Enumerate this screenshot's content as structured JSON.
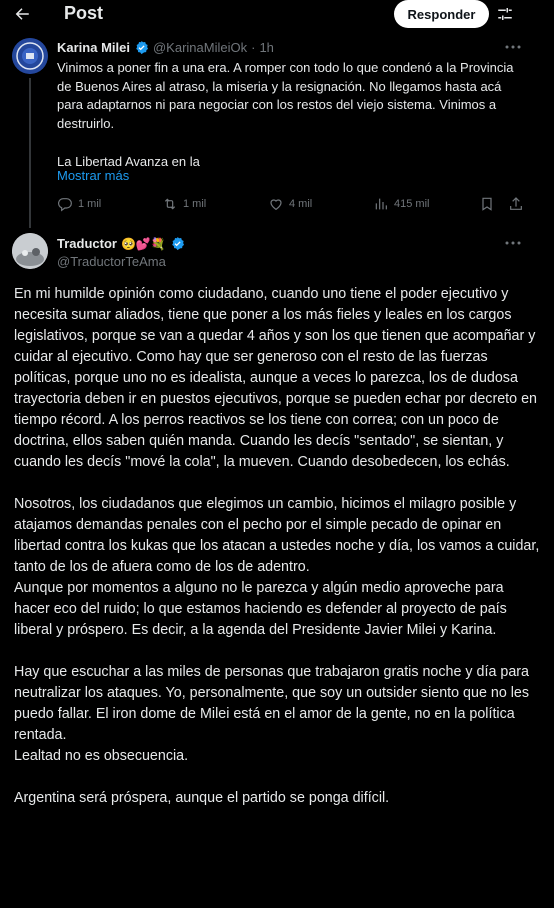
{
  "header": {
    "title": "Post",
    "reply_button": "Responder"
  },
  "quoted_tweet": {
    "display_name": "Karina Milei",
    "handle": "@KarinaMileiOk",
    "separator": "·",
    "time": "1h",
    "text_lines": [
      "Vinimos a poner fin a una era. A romper con todo lo que condenó a la Provincia de Buenos Aires al atraso, la miseria y la resignación. No llegamos hasta acá para adaptarnos ni para negociar con los restos del viejo sistema. Vinimos a destruirlo.",
      "La Libertad Avanza en la"
    ],
    "show_more": "Mostrar más",
    "stats": {
      "replies": "1 mil",
      "retweets": "1 mil",
      "likes": "4 mil",
      "views": "415 mil"
    }
  },
  "reply_tweet": {
    "display_name": "Traductor",
    "emojis": "🥺💕💐",
    "handle": "@TraductorTeAma",
    "paragraphs": [
      "En mi humilde opinión como ciudadano, cuando uno tiene el poder ejecutivo y necesita sumar aliados, tiene que poner a los más fieles y leales en los cargos legislativos, porque se van a quedar 4 años y son los que tienen que acompañar y cuidar al ejecutivo. Como hay que ser generoso con el resto de las fuerzas políticas, porque uno no es idealista, aunque a veces lo parezca, los de dudosa trayectoria deben ir en puestos ejecutivos, porque se pueden echar por decreto en tiempo récord. A los perros reactivos se los tiene con correa; con un poco de doctrina, ellos saben quién manda. Cuando les decís \"sentado\", se sientan, y cuando les decís \"mové la cola\", la mueven. Cuando desobedecen, los echás.",
      "",
      "Nosotros, los ciudadanos que elegimos un cambio, hicimos el milagro posible y atajamos demandas penales con el pecho por el simple pecado de opinar en libertad contra los kukas que los atacan a ustedes noche y día, los vamos a cuidar, tanto de los de afuera como de los de adentro.",
      "Aunque por momentos a alguno no le parezca y algún medio aproveche para hacer eco del ruido; lo que estamos haciendo es defender al proyecto de país liberal y próspero. Es decir, a la agenda del Presidente Javier Milei y Karina.",
      "",
      "Hay que escuchar a las miles de personas que trabajaron gratis noche y día para neutralizar los ataques. Yo, personalmente, que soy un outsider siento que no les puedo fallar. El iron dome de Milei está en el amor de la gente, no en la política rentada.",
      "Lealtad no es obsecuencia.",
      "",
      "Argentina será próspera, aunque el partido se ponga difícil."
    ]
  },
  "icons": {
    "back": "back-arrow-icon",
    "settings": "sliders-icon",
    "more": "more-dots-icon",
    "verified": "verified-badge-icon",
    "reply": "reply-icon",
    "retweet": "retweet-icon",
    "like": "heart-icon",
    "views": "views-chart-icon",
    "bookmark": "bookmark-icon",
    "share": "share-icon"
  },
  "colors": {
    "background": "#000000",
    "text": "#e7e9ea",
    "secondary": "#71767b",
    "link": "#1d9bf0",
    "verified": "#1d9bf0"
  }
}
